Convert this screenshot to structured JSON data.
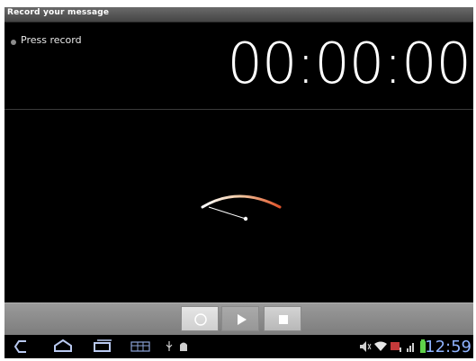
{
  "window": {
    "title": "Record your message"
  },
  "status": {
    "indicator_text": "Press record"
  },
  "timer": {
    "display": "00:00:00"
  },
  "level_meter": {
    "level": 0.0,
    "colors": {
      "low": "#ffffff",
      "high": "#e0542a"
    }
  },
  "controls": {
    "record_icon": "record-icon",
    "play_icon": "play-icon",
    "stop_icon": "stop-icon",
    "play_enabled": false
  },
  "system_bar": {
    "nav_icons": [
      "back-icon",
      "home-icon",
      "recent-apps-icon",
      "keyboard-icon"
    ],
    "notification_icons": [
      "usb-icon",
      "android-debug-icon"
    ],
    "status_icons": [
      "mute-icon",
      "wifi-icon",
      "signal-icon",
      "battery-icon"
    ],
    "clock": "12:59",
    "accent": "#8fb3ff"
  }
}
